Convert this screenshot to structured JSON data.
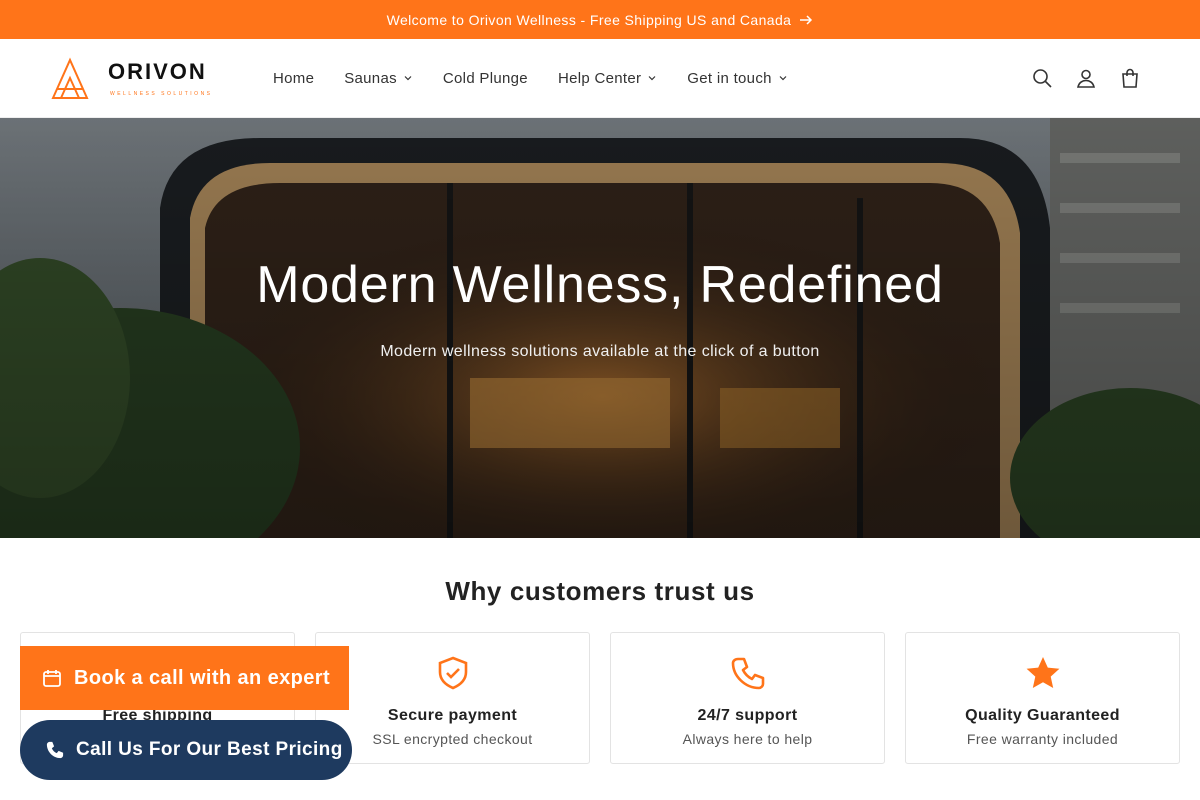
{
  "announcement": {
    "text": "Welcome to Orivon Wellness - Free Shipping US and Canada",
    "icon": "arrow-right-icon"
  },
  "brand": {
    "name": "ORIVON",
    "tagline": "WELLNESS SOLUTIONS",
    "accent": "#ff7419",
    "navy": "#1e3a5f"
  },
  "nav": {
    "items": [
      {
        "label": "Home",
        "dropdown": false
      },
      {
        "label": "Saunas",
        "dropdown": true
      },
      {
        "label": "Cold Plunge",
        "dropdown": false
      },
      {
        "label": "Help Center",
        "dropdown": true
      },
      {
        "label": "Get in touch",
        "dropdown": true
      }
    ]
  },
  "header_icons": [
    "search-icon",
    "account-icon",
    "cart-icon"
  ],
  "hero": {
    "title": "Modern Wellness, Redefined",
    "subtitle": "Modern wellness solutions available at the click of a button"
  },
  "trust": {
    "title": "Why customers trust us",
    "cards": [
      {
        "title": "Free shipping",
        "subtitle": "",
        "icon": "truck-icon"
      },
      {
        "title": "Secure payment",
        "subtitle": "SSL encrypted checkout",
        "icon": "shield-check-icon"
      },
      {
        "title": "24/7 support",
        "subtitle": "Always here to help",
        "icon": "phone-icon"
      },
      {
        "title": "Quality Guaranteed",
        "subtitle": "Free warranty included",
        "icon": "star-icon"
      }
    ]
  },
  "floating": {
    "book_label": "Book a call with an expert",
    "call_label": "Call Us For Our Best Pricing"
  }
}
